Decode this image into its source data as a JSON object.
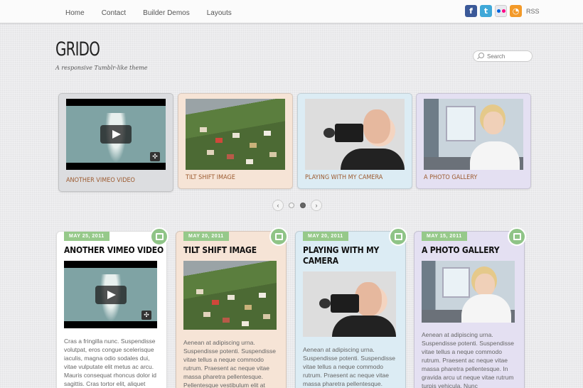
{
  "nav": [
    "Home",
    "Contact",
    "Builder Demos",
    "Layouts"
  ],
  "social": {
    "rss_label": "RSS"
  },
  "site": {
    "title": "GRIDO",
    "tagline": "A responsive Tumblr-like theme"
  },
  "search": {
    "placeholder": "Search"
  },
  "slider": [
    {
      "title": "ANOTHER VIMEO VIDEO",
      "color": "#dcdde0"
    },
    {
      "title": "TILT SHIFT IMAGE",
      "color": "#f6e4d6"
    },
    {
      "title": "PLAYING WITH MY CAMERA",
      "color": "#dcecf4"
    },
    {
      "title": "A PHOTO GALLERY",
      "color": "#e4e0f2"
    }
  ],
  "pager": {
    "prev": "‹",
    "next": "›"
  },
  "posts": [
    {
      "date": "MAY 25, 2011",
      "title": "ANOTHER VIMEO VIDEO",
      "icon": "video-icon",
      "excerpt": "Cras a fringilla nunc. Suspendisse volutpat, eros congue scelerisque iaculis, magna odio sodales dui, vitae vulputate elit metus ac arcu. Mauris consequat rhoncus dolor id sagittis. Cras tortor elit, aliquet"
    },
    {
      "date": "MAY 20, 2011",
      "title": "TILT SHIFT IMAGE",
      "icon": "image-icon",
      "excerpt": "Aenean at adipiscing urna. Suspendisse potenti. Suspendisse vitae tellus a neque commodo rutrum. Praesent ac neque vitae massa pharetra pellentesque. Pellentesque vestibulum elit at"
    },
    {
      "date": "MAY 20, 2011",
      "title": "PLAYING WITH MY CAMERA",
      "icon": "image-icon",
      "excerpt": "Aenean at adipiscing urna. Suspendisse potenti. Suspendisse vitae tellus a neque commodo rutrum. Praesent ac neque vitae massa pharetra pellentesque."
    },
    {
      "date": "MAY 15, 2011",
      "title": "A PHOTO GALLERY",
      "icon": "gallery-icon",
      "excerpt": "Aenean at adipiscing urna. Suspendisse potenti. Suspendisse vitae tellus a neque commodo rutrum. Praesent ac neque vitae massa pharetra pellentesque. In gravida arcu ut neque vitae rutrum turpis vehicula. Nunc"
    }
  ]
}
